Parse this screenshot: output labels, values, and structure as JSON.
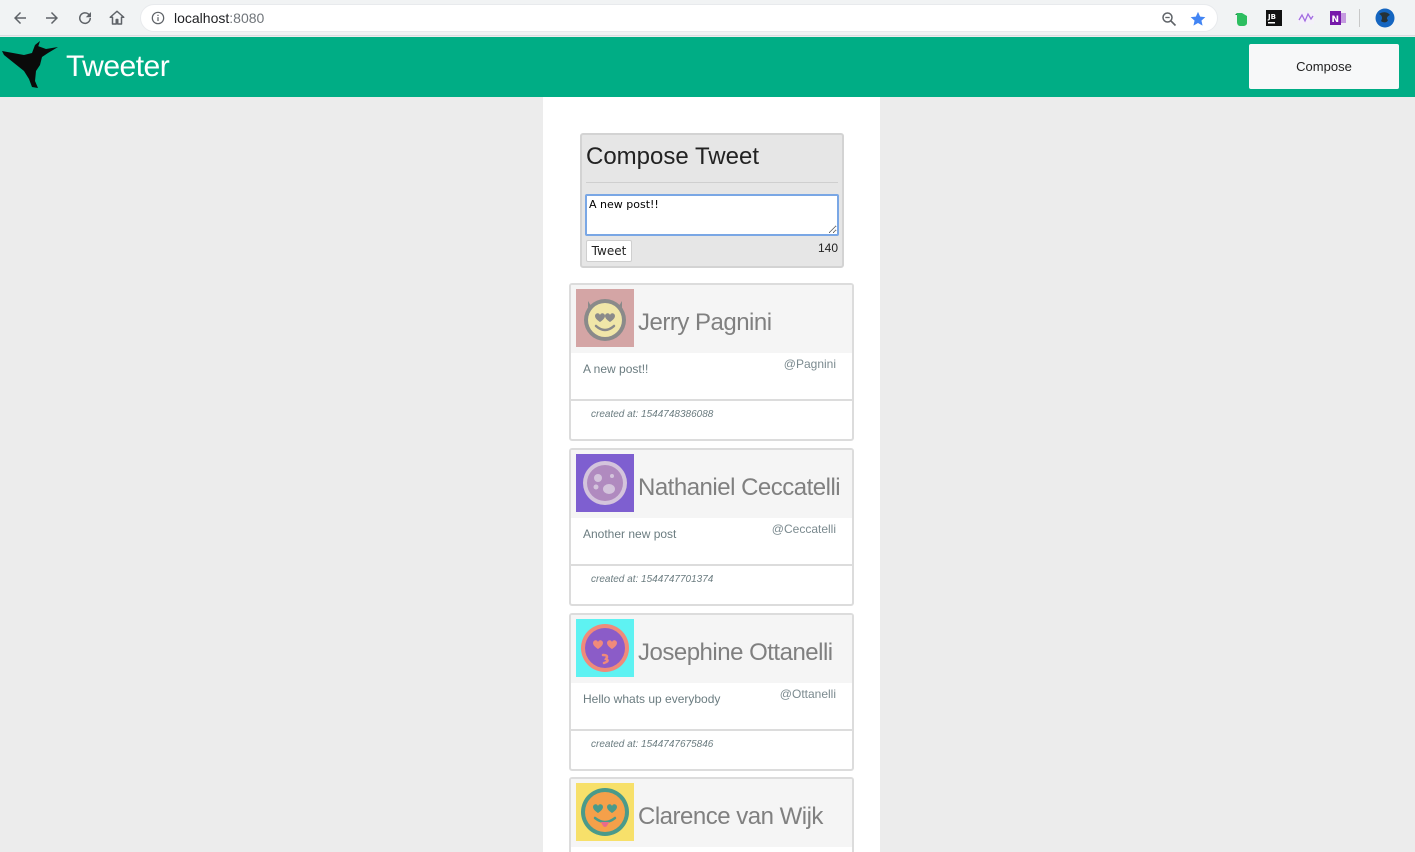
{
  "browser": {
    "url_host": "localhost",
    "url_port": ":8080",
    "colors": {
      "star": "#4285f4"
    }
  },
  "header": {
    "brand": "Tweeter",
    "compose_label": "Compose",
    "color": "#00ad85"
  },
  "compose": {
    "title": "Compose Tweet",
    "textarea_value": "A new post!!",
    "tweet_button": "Tweet",
    "counter": "140"
  },
  "tweets": [
    {
      "name": "Jerry Pagnini",
      "handle": "@Pagnini",
      "text": "A new post!!",
      "created": "created at: 1544748386088",
      "avatar_bg": "#d4a5a5"
    },
    {
      "name": "Nathaniel Ceccatelli",
      "handle": "@Ceccatelli",
      "text": "Another new post",
      "created": "created at: 1544747701374",
      "avatar_bg": "#7e5fd0"
    },
    {
      "name": "Josephine Ottanelli",
      "handle": "@Ottanelli",
      "text": "Hello whats up everybody",
      "created": "created at: 1544747675846",
      "avatar_bg": "#5ef2f2"
    },
    {
      "name": "Clarence van Wijk",
      "handle": "",
      "text": "",
      "created": "",
      "avatar_bg": "#f7e06a"
    }
  ]
}
